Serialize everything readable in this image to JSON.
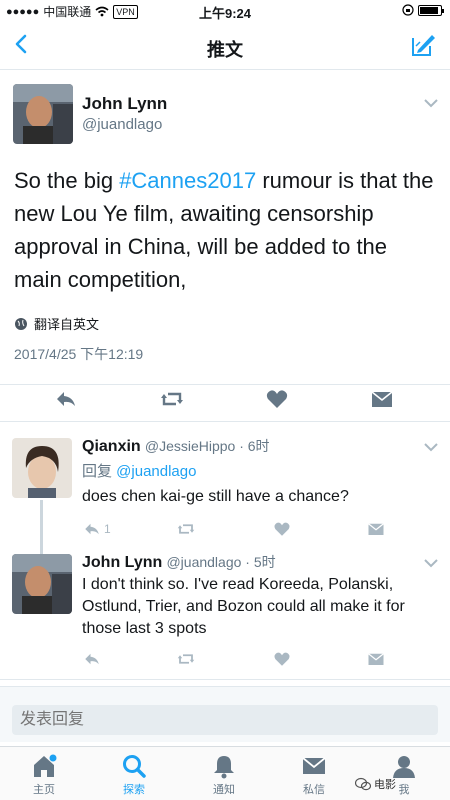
{
  "status": {
    "carrier": "中国联通",
    "vpn": "VPN",
    "time": "上午9:24"
  },
  "nav": {
    "title": "推文"
  },
  "main_tweet": {
    "name": "John Lynn",
    "handle": "@juandlago",
    "text_prefix": "So the big ",
    "hashtag": "#Cannes2017",
    "text_suffix": " rumour is that the new Lou Ye film, awaiting censorship approval in China, will be added to the main competition,",
    "translate_label": "翻译自英文",
    "timestamp": "2017/4/25 下午12:19"
  },
  "replies": [
    {
      "name": "Qianxin",
      "meta": "@JessieHippo · 6时",
      "reply_to_label": "回复 ",
      "reply_to_handle": "@juandlago",
      "text": "does chen kai-ge still have a chance?",
      "reply_count": "1"
    },
    {
      "name": "John Lynn",
      "meta": "@juandlago · 5时",
      "text": "I don't think so.  I've read Koreeda, Polanski, Ostlund, Trier, and Bozon could all make it for those last 3 spots"
    }
  ],
  "compose": {
    "placeholder": "发表回复"
  },
  "tabs": [
    {
      "label": "主页",
      "icon": "home-icon"
    },
    {
      "label": "探索",
      "icon": "search-icon"
    },
    {
      "label": "通知",
      "icon": "bell-icon"
    },
    {
      "label": "私信",
      "icon": "mail-icon"
    },
    {
      "label": "我",
      "icon": "person-icon"
    }
  ],
  "watermark": "电影",
  "colors": {
    "accent": "#1da1f2",
    "muted": "#657786",
    "icon_gray": "#aab8c2",
    "divider": "#e1e8ed"
  }
}
